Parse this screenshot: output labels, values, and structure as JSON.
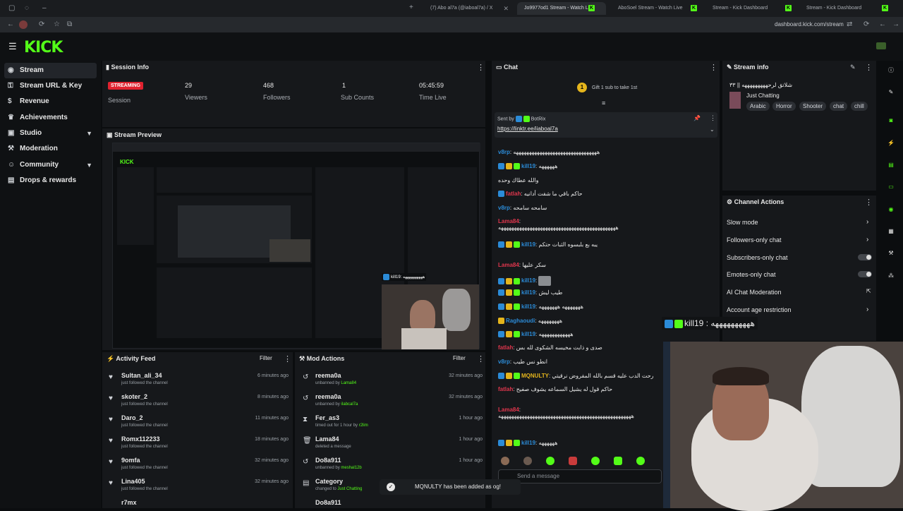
{
  "browser": {
    "tabs": [
      {
        "label": "(7) Abo al7a (@iaboal7a) / X",
        "active": false
      },
      {
        "label": "Jo9977od1 Stream - Watch Live",
        "active": true
      },
      {
        "label": "AboSoel Stream - Watch Live",
        "active": false
      },
      {
        "label": "Stream - Kick Dashboard",
        "active": false
      },
      {
        "label": "Stream - Kick Dashboard",
        "active": false
      }
    ],
    "url": "dashboard.kick.com/stream"
  },
  "brand": {
    "logo": "KICK",
    "accent": "#53fc18"
  },
  "sidebar": {
    "items": [
      {
        "label": "Stream",
        "icon": "broadcast-icon",
        "active": true,
        "expand": false
      },
      {
        "label": "Stream URL & Key",
        "icon": "key-icon",
        "active": false,
        "expand": false
      },
      {
        "label": "Revenue",
        "icon": "money-icon",
        "active": false,
        "expand": false
      },
      {
        "label": "Achievements",
        "icon": "trophy-icon",
        "active": false,
        "expand": false
      },
      {
        "label": "Studio",
        "icon": "studio-icon",
        "active": false,
        "expand": true
      },
      {
        "label": "Moderation",
        "icon": "hammer-icon",
        "active": false,
        "expand": false
      },
      {
        "label": "Community",
        "icon": "people-icon",
        "active": false,
        "expand": true
      },
      {
        "label": "Drops & rewards",
        "icon": "gift-icon",
        "active": false,
        "expand": false
      }
    ]
  },
  "session": {
    "title": "Session Info",
    "status": "STREAMING",
    "status_label": "Session",
    "stats": [
      {
        "value": "29",
        "label": "Viewers"
      },
      {
        "value": "468",
        "label": "Followers"
      },
      {
        "value": "1",
        "label": "Sub Counts"
      },
      {
        "value": "05:45:59",
        "label": "Time Live"
      }
    ]
  },
  "preview": {
    "title": "Stream Preview",
    "overlay_user": "kill19",
    "overlay_text": "ههههههههههه"
  },
  "activity": {
    "title": "Activity Feed",
    "filter": "Filter",
    "items": [
      {
        "user": "Sultan_ali_34",
        "action": "just followed the channel",
        "time": "6 minutes ago"
      },
      {
        "user": "skoter_2",
        "action": "just followed the channel",
        "time": "8 minutes ago"
      },
      {
        "user": "Daro_2",
        "action": "just followed the channel",
        "time": "11 minutes ago"
      },
      {
        "user": "Romx112233",
        "action": "just followed the channel",
        "time": "18 minutes ago"
      },
      {
        "user": "9omfa",
        "action": "just followed the channel",
        "time": "32 minutes ago"
      },
      {
        "user": "Lina405",
        "action": "just followed the channel",
        "time": "32 minutes ago"
      },
      {
        "user": "r7mx",
        "action": "",
        "time": ""
      }
    ]
  },
  "mod": {
    "title": "Mod Actions",
    "filter": "Filter",
    "items": [
      {
        "user": "reema0a",
        "action": "unbanned by",
        "by": "Lama84",
        "time": "32 minutes ago",
        "icon": "unban-icon"
      },
      {
        "user": "reema0a",
        "action": "unbanned by",
        "by": "iIabcal7a",
        "time": "32 minutes ago",
        "icon": "unban-icon"
      },
      {
        "user": "Fer_as3",
        "action": "timed out for 1 hour by",
        "by": "r2lim",
        "time": "1 hour ago",
        "icon": "timeout-icon"
      },
      {
        "user": "Lama84",
        "action": "deleted a message",
        "by": "",
        "time": "1 hour ago",
        "icon": "trash-icon"
      },
      {
        "user": "Do8a911",
        "action": "unbanned by",
        "by": "meshal12b",
        "time": "1 hour ago",
        "icon": "unban-icon"
      },
      {
        "user": "Category",
        "action": "changed to",
        "by": "Just Chatting",
        "time": "",
        "icon": "category-icon"
      },
      {
        "user": "Do8a911",
        "action": "",
        "by": "",
        "time": "",
        "icon": "unban-icon"
      }
    ]
  },
  "chat": {
    "title": "Chat",
    "gift_banner": "Gift 1 sub to take 1st",
    "pinned_label": "Sent by",
    "pinned_user": "BotRix",
    "pinned_link": "https://linktr.ee/iiaboal7a",
    "placeholder": "Send a message",
    "messages": [
      {
        "user": "v8rp",
        "color": "#2b8bd7",
        "text": "ههههههههههههههههههههههههههههههههه",
        "badges": 0
      },
      {
        "user": "kill19",
        "color": "#2b8bd7",
        "text": "ههههههه",
        "badges": 3
      },
      {
        "user": "",
        "color": "#e8e8e8",
        "text": "والله عطاك وحده",
        "badges": 0
      },
      {
        "user": "fatlah",
        "color": "#e0364d",
        "text": "حاكم باقي ما شفت أدانيه",
        "badges": 1
      },
      {
        "user": "v8rp",
        "color": "#2b8bd7",
        "text": "سامحه سامحه",
        "badges": 0
      },
      {
        "user": "Lama84",
        "color": "#e0364d",
        "text": "هههههههههههههههههههههههههههههههههههههههههههههه",
        "badges": 0
      },
      {
        "user": "kill19",
        "color": "#2b8bd7",
        "text": "يبه بع بلبسوه الثبات حتكم",
        "badges": 3
      },
      {
        "user": "Lama84",
        "color": "#e0364d",
        "text": "سكر عليها",
        "badges": 0
      },
      {
        "user": "kill19",
        "color": "#2b8bd7",
        "text": "",
        "badges": 3
      },
      {
        "user": "kill19",
        "color": "#2b8bd7",
        "text": "طيب ليش",
        "badges": 3
      },
      {
        "user": "kill19",
        "color": "#2b8bd7",
        "text": "هههههههه هههههههه",
        "badges": 3
      },
      {
        "user": "Raghaoudi",
        "color": "#2b8bd7",
        "text": "ههههههههه",
        "badges": 1
      },
      {
        "user": "kill19",
        "color": "#2b8bd7",
        "text": "ههههههههههههه",
        "badges": 3
      },
      {
        "user": "fatlah",
        "color": "#e0364d",
        "text": "صدى و ذابت مخيسه الشكوى لله بس",
        "badges": 0
      },
      {
        "user": "v8rp",
        "color": "#2b8bd7",
        "text": "انطو نس طيب",
        "badges": 0
      },
      {
        "user": "MQNULTY",
        "color": "#e5b51c",
        "text": "رحت الدب عليه قسم بالله المفروض نرقيتي",
        "badges": 3
      },
      {
        "user": "fatlah",
        "color": "#e0364d",
        "text": "حاكم قول له يشيل السماعه يشوف صفيح",
        "badges": 0
      },
      {
        "user": "Lama84",
        "color": "#e0364d",
        "text": "هههههههههههههههههههههههههههههههههههههههههههههههههههه",
        "badges": 0
      },
      {
        "user": "kill19",
        "color": "#2b8bd7",
        "text": "ههههههه",
        "badges": 3
      }
    ]
  },
  "stream_info": {
    "title": "Stream info",
    "stream_title": "شلاتق لرحهههههههههه || ٣٣",
    "category": "Just Chatting",
    "tags": [
      "Arabic",
      "Horror",
      "Shooter",
      "chat",
      "chill"
    ]
  },
  "channel_actions": {
    "title": "Channel Actions",
    "items": [
      {
        "label": "Slow mode",
        "control": "chevron"
      },
      {
        "label": "Followers-only chat",
        "control": "chevron"
      },
      {
        "label": "Subscribers-only chat",
        "control": "toggle"
      },
      {
        "label": "Emotes-only chat",
        "control": "toggle"
      },
      {
        "label": "AI Chat Moderation",
        "control": "external"
      },
      {
        "label": "Account age restriction",
        "control": "chevron"
      }
    ]
  },
  "overlay": {
    "user": "kill19",
    "text": "ههههههههههه"
  },
  "toast": {
    "text": "MQNULTY has been added as og!"
  }
}
